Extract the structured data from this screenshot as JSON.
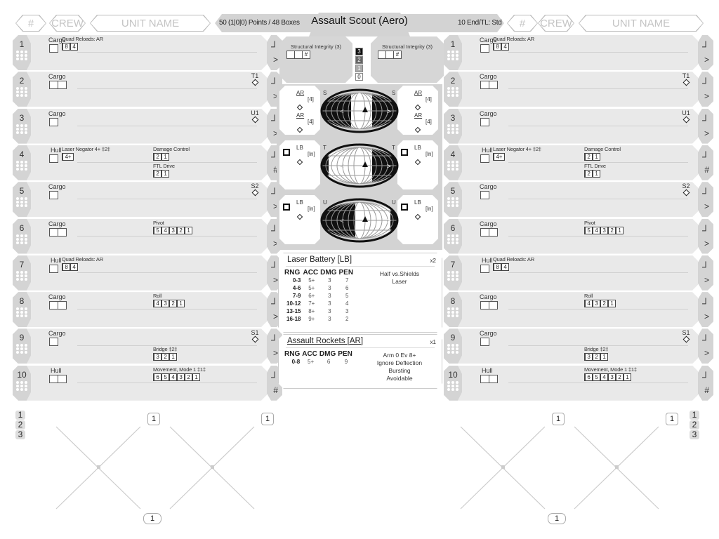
{
  "header": {
    "title": "Assault Scout (Aero)",
    "points": "50 (1|0|0) Points / 48 Boxes",
    "endurance": "10 End/TL: Std",
    "left": {
      "number_placeholder": "#",
      "crew_placeholder": "CREW",
      "unit_name_placeholder": "UNIT NAME"
    },
    "right": {
      "number_placeholder": "#",
      "crew_placeholder": "CREW",
      "unit_name_placeholder": "UNIT NAME"
    }
  },
  "rows": [
    {
      "num": "1",
      "loc": "Cargo",
      "loc_boxes": 1,
      "items": [
        {
          "label": "Quad Reloads: AR",
          "tracks": [
            "8",
            "4"
          ],
          "col": 0,
          "line": 0
        }
      ],
      "mount": null,
      "glyph_bottom": ">"
    },
    {
      "num": "2",
      "loc": "Cargo",
      "loc_boxes": 2,
      "items": [],
      "mount": "T1",
      "glyph_bottom": ">"
    },
    {
      "num": "3",
      "loc": "Cargo",
      "loc_boxes": 1,
      "items": [],
      "mount": "U1",
      "glyph_bottom": ">"
    },
    {
      "num": "4",
      "loc": "Hull",
      "loc_boxes": 1,
      "items": [
        {
          "label": "Laser Negator 4+ ‡2‡",
          "tracks": [
            "4+"
          ],
          "col": 0,
          "line": 0
        },
        {
          "label": "Damage Control",
          "tracks": [
            "2",
            "1"
          ],
          "col": 1,
          "line": 0
        },
        {
          "label": "FTL Drive",
          "tracks": [
            "2",
            "1"
          ],
          "col": 1,
          "line": 1
        }
      ],
      "mount": null,
      "glyph_bottom": "#"
    },
    {
      "num": "5",
      "loc": "Cargo",
      "loc_boxes": 1,
      "items": [],
      "mount": "S2",
      "glyph_bottom": ">"
    },
    {
      "num": "6",
      "loc": "Cargo",
      "loc_boxes": 2,
      "items": [
        {
          "label": "Pivot",
          "tracks": [
            "5",
            "4",
            "3",
            "2",
            "1"
          ],
          "col": 1,
          "line": 0
        }
      ],
      "mount": null,
      "glyph_bottom": ">"
    },
    {
      "num": "7",
      "loc": "Hull",
      "loc_boxes": 1,
      "items": [
        {
          "label": "Quad Reloads: AR",
          "tracks": [
            "8",
            "4"
          ],
          "col": 0,
          "line": 0
        }
      ],
      "mount": null,
      "glyph_bottom": ">"
    },
    {
      "num": "8",
      "loc": "Cargo",
      "loc_boxes": 2,
      "items": [
        {
          "label": "Roll",
          "tracks": [
            "4",
            "3",
            "2",
            "1"
          ],
          "col": 1,
          "line": 0
        }
      ],
      "mount": null,
      "glyph_bottom": ">"
    },
    {
      "num": "9",
      "loc": "Cargo",
      "loc_boxes": 1,
      "items": [
        {
          "label": "Bridge ‡2‡",
          "tracks": [
            "3",
            "2",
            "1"
          ],
          "col": 1,
          "line": 1
        }
      ],
      "mount": "S1",
      "glyph_bottom": ">"
    },
    {
      "num": "10",
      "loc": "Hull",
      "loc_boxes": 2,
      "items": [
        {
          "label": "Movement, Mode 1 ‡1‡",
          "tracks": [
            "6",
            "5",
            "4",
            "3",
            "2",
            "1"
          ],
          "col": 1,
          "line": 0
        }
      ],
      "mount": null,
      "glyph_bottom": "#"
    }
  ],
  "row_glyph_top": "┘",
  "structural": {
    "label": "Structural Integrity (3)",
    "boxes": [
      "",
      "",
      "#"
    ],
    "levels": [
      "3",
      "2",
      "1",
      "0"
    ]
  },
  "arcs": [
    {
      "arc": "S",
      "left": {
        "weapons": [
          {
            "name": "AR",
            "count": "[4]"
          },
          {
            "name": "AR",
            "count": "[4]"
          }
        ]
      },
      "right": {
        "weapons": [
          {
            "name": "AR",
            "count": "[4]"
          },
          {
            "name": "AR",
            "count": "[4]"
          }
        ]
      }
    },
    {
      "arc": "T",
      "left": {
        "weapons": [
          {
            "name": "LB",
            "count": "[ln]"
          }
        ]
      },
      "right": {
        "weapons": [
          {
            "name": "LB",
            "count": "[ln]"
          }
        ]
      }
    },
    {
      "arc": "U",
      "left": {
        "weapons": [
          {
            "name": "LB",
            "count": "[ln]"
          }
        ]
      },
      "right": {
        "weapons": [
          {
            "name": "LB",
            "count": "[ln]"
          }
        ]
      }
    }
  ],
  "weapons": [
    {
      "name": "Laser Battery [LB]",
      "count": "x2",
      "headers": [
        "RNG",
        "ACC",
        "DMG",
        "PEN"
      ],
      "rows": [
        [
          "0-3",
          "5+",
          "3",
          "7"
        ],
        [
          "4-6",
          "5+",
          "3",
          "6"
        ],
        [
          "7-9",
          "6+",
          "3",
          "5"
        ],
        [
          "10-12",
          "7+",
          "3",
          "4"
        ],
        [
          "13-15",
          "8+",
          "3",
          "3"
        ],
        [
          "16-18",
          "9+",
          "3",
          "2"
        ]
      ],
      "notes": [
        "Half vs.Shields",
        "Laser"
      ]
    },
    {
      "name": "Assault Rockets [AR]",
      "count": "x1",
      "headers": [
        "RNG",
        "ACC",
        "DMG",
        "PEN"
      ],
      "rows": [
        [
          "0-8",
          "5+",
          "6",
          "9"
        ]
      ],
      "notes": [
        "Arm 0 Ev 8+",
        "Ignore Deflection",
        "Bursting",
        "Avoidable"
      ]
    }
  ],
  "bottom": {
    "row_selector": [
      "1",
      "2",
      "3"
    ],
    "pins": {
      "altitude": "1",
      "heading": "1",
      "speed": "1"
    }
  }
}
